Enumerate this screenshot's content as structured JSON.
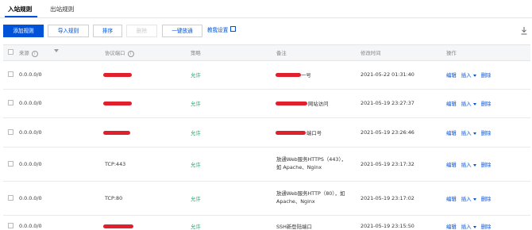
{
  "tabs": [
    {
      "label": "入站规则",
      "active": true
    },
    {
      "label": "出站规则",
      "active": false
    }
  ],
  "toolbar": {
    "add_rule": "添加规则",
    "import_rule": "导入规则",
    "sort": "排序",
    "delete": "删除",
    "one_click_open": "一键放通",
    "teach_setup": "教我设置",
    "download_icon": "download-icon"
  },
  "table": {
    "headers": {
      "source": "来源",
      "protocol_port": "协议端口",
      "policy": "策略",
      "note": "备注",
      "modified_time": "修改时间",
      "operation": "操作"
    },
    "rows": [
      {
        "source": "0.0.0.0/0",
        "port": "",
        "policy": "允许",
        "note_lines": [
          "一号"
        ],
        "time": "2021-05-22 01:31:40",
        "op_edit": "编辑",
        "op_insert": "插入",
        "op_delete": "删除"
      },
      {
        "source": "0.0.0.0/0",
        "port": "",
        "policy": "允许",
        "note_lines": [
          "网站访问"
        ],
        "time": "2021-05-19 23:27:37",
        "op_edit": "编辑",
        "op_insert": "插入",
        "op_delete": "删除"
      },
      {
        "source": "0.0.0.0/0",
        "port": "",
        "policy": "允许",
        "note_lines": [
          "端口号"
        ],
        "time": "2021-05-19 23:26:46",
        "op_edit": "编辑",
        "op_insert": "插入",
        "op_delete": "删除"
      },
      {
        "source": "0.0.0.0/0",
        "port": "TCP:443",
        "policy": "允许",
        "note_lines": [
          "放通Web服务HTTPS（443），",
          "如 Apache、Nginx"
        ],
        "time": "2021-05-19 23:17:32",
        "op_edit": "编辑",
        "op_insert": "插入",
        "op_delete": "删除"
      },
      {
        "source": "0.0.0.0/0",
        "port": "TCP:80",
        "policy": "允许",
        "note_lines": [
          "放通Web服务HTTP（80），如",
          "Apache、Nginx"
        ],
        "time": "2021-05-19 23:17:02",
        "op_edit": "编辑",
        "op_insert": "插入",
        "op_delete": "删除"
      },
      {
        "source": "0.0.0.0/0",
        "port": "",
        "policy": "允许",
        "note_lines": [
          "SSH新登陆端口"
        ],
        "time": "2021-05-19 23:15:50",
        "op_edit": "编辑",
        "op_insert": "插入",
        "op_delete": "删除"
      }
    ]
  },
  "colors": {
    "primary": "#0052d9",
    "allow": "#2ba471",
    "redaction": "#e0202c"
  }
}
